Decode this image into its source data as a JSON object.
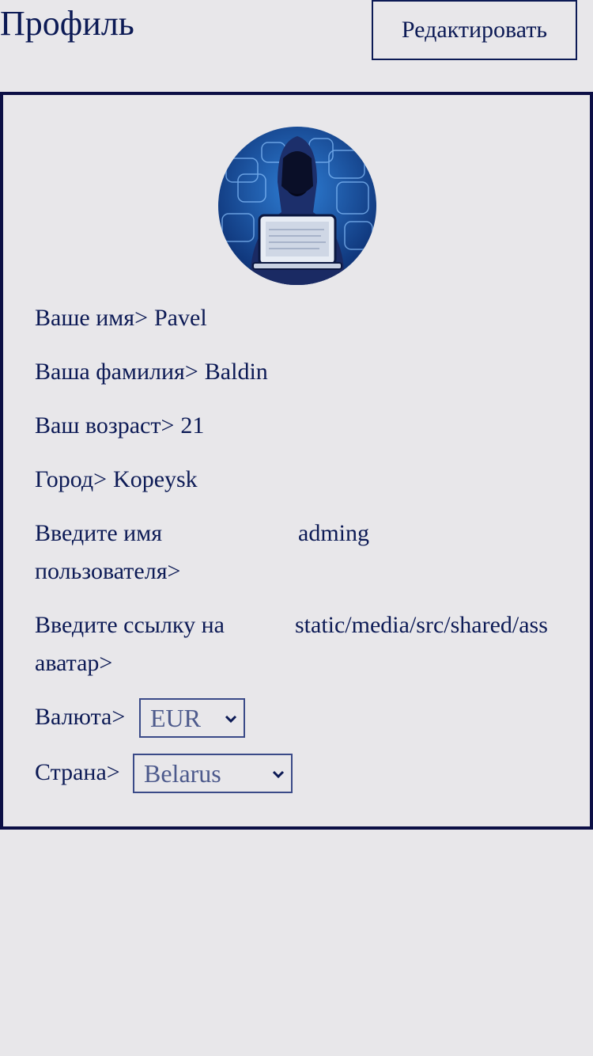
{
  "header": {
    "title": "Профиль",
    "edit_label": "Редактировать"
  },
  "profile": {
    "avatar_icon": "hacker-avatar",
    "first_name_label": "Ваше имя>",
    "first_name": "Pavel",
    "last_name_label": "Ваша фамилия>",
    "last_name": "Baldin",
    "age_label": "Ваш возраст>",
    "age": "21",
    "city_label": "Город>",
    "city": "Kopeysk",
    "username_label": "Введите имя пользователя>",
    "username_value": "adming",
    "avatar_link_label": "Введите ссылку на аватар>",
    "avatar_link_value": "static/media/src/shared/ass",
    "currency_label": "Валюта>",
    "currency_value": "EUR",
    "country_label": "Страна>",
    "country_value": "Belarus"
  },
  "colors": {
    "background": "#e8e7ea",
    "text": "#0c1a55",
    "border": "#0c0f45"
  }
}
